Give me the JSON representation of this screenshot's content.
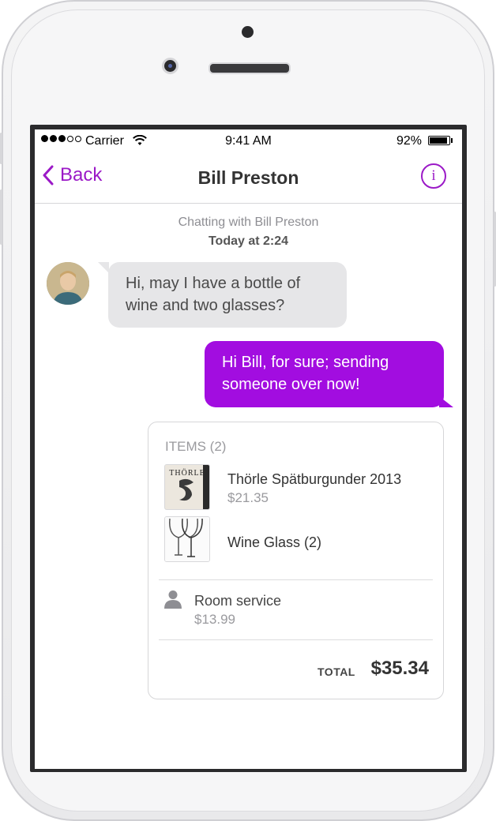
{
  "status_bar": {
    "carrier": "Carrier",
    "time": "9:41 AM",
    "battery_percent": "92%",
    "battery_level": 0.92
  },
  "nav": {
    "back_label": "Back",
    "title": "Bill Preston",
    "info_label": "i"
  },
  "chat": {
    "header": "Chatting with Bill Preston",
    "timestamp": "Today at 2:24",
    "messages": [
      {
        "from": "contact",
        "text_line1": "Hi, may I have a bottle of",
        "text_line2": "wine and two glasses?"
      },
      {
        "from": "me",
        "text_line1": "Hi Bill, for sure; sending",
        "text_line2": "someone over now!"
      }
    ]
  },
  "order": {
    "items_header": "ITEMS (2)",
    "items": [
      {
        "name": "Thörle Spätburgunder 2013",
        "price": "$21.35"
      },
      {
        "name": "Wine Glass (2)",
        "price": ""
      }
    ],
    "wine_label_text": "THÖRLE",
    "service": {
      "name": "Room service",
      "price": "$13.99",
      "icon": "person-icon"
    },
    "total_label": "TOTAL",
    "total_value": "$35.34"
  },
  "colors": {
    "accent": "#9b19c7",
    "outgoing_bubble": "#a20de0",
    "incoming_bubble": "#e6e6e8"
  }
}
